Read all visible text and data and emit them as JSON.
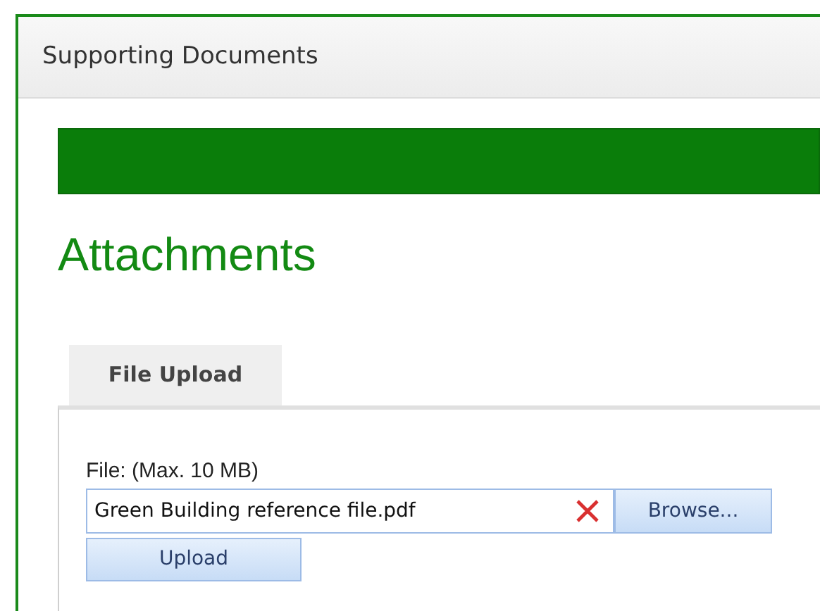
{
  "window": {
    "title": "Supporting Documents"
  },
  "heading": "Attachments",
  "tabs": [
    {
      "label": "File Upload",
      "selected": true
    }
  ],
  "upload": {
    "label": "File: (Max. 10 MB)",
    "file_value": "Green Building reference file.pdf",
    "browse_button": "Browse...",
    "upload_button": "Upload"
  }
}
